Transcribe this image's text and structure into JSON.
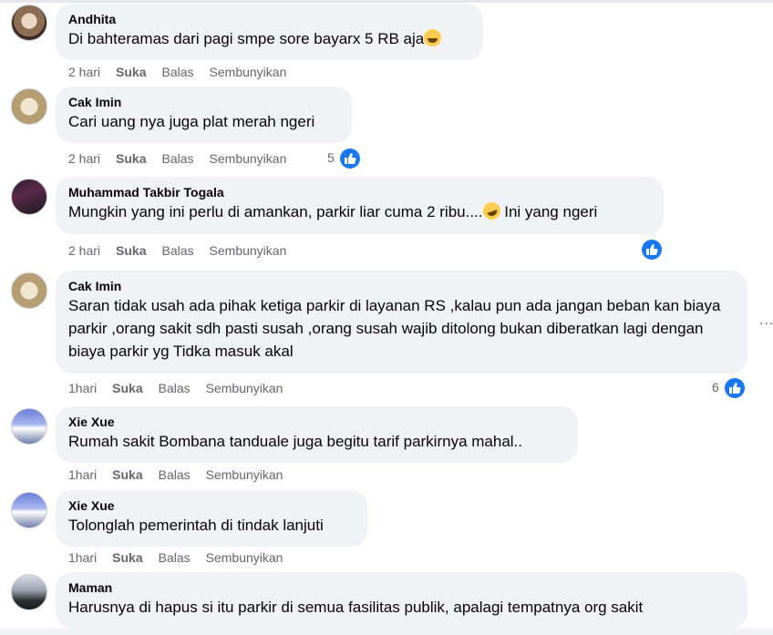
{
  "comments": [
    {
      "author": "Andhita",
      "text": "Di bahteramas dari pagi smpe sore bayarx 5 RB aja",
      "emoji": "smiling-face-icon",
      "time": "2 hari",
      "like": "Suka",
      "reply": "Balas",
      "hide": "Sembunyikan"
    },
    {
      "author": "Cak Imin",
      "text": "Cari uang nya juga plat merah ngeri",
      "time": "2 hari",
      "like": "Suka",
      "reply": "Balas",
      "hide": "Sembunyikan",
      "reaction_count": "5"
    },
    {
      "author": "Muhammad Takbir Togala",
      "text_before": "Mungkin yang ini perlu di amankan, parkir liar cuma 2 ribu....",
      "emoji": "rolling-laughing-icon",
      "text_after": " Ini yang ngeri",
      "time": "2 hari",
      "like": "Suka",
      "reply": "Balas",
      "hide": "Sembunyikan"
    },
    {
      "author": "Cak Imin",
      "text": "Saran tidak usah ada pihak ketiga parkir di layanan RS ,kalau pun ada jangan beban kan biaya parkir ,orang sakit sdh pasti susah ,orang susah wajib ditolong bukan diberatkan lagi dengan biaya parkir yg Tidka masuk akal",
      "time": "1hari",
      "like": "Suka",
      "reply": "Balas",
      "hide": "Sembunyikan",
      "reaction_count": "6"
    },
    {
      "author": "Xie Xue",
      "text": "Rumah sakit Bombana tanduale juga begitu tarif parkirnya mahal..",
      "time": "1hari",
      "like": "Suka",
      "reply": "Balas",
      "hide": "Sembunyikan"
    },
    {
      "author": "Xie Xue",
      "text": "Tolonglah pemerintah di tindak lanjuti",
      "time": "1hari",
      "like": "Suka",
      "reply": "Balas",
      "hide": "Sembunyikan"
    },
    {
      "author": "Maman",
      "text": "Harusnya di hapus si itu parkir di semua fasilitas publik, apalagi tempatnya org sakit"
    }
  ],
  "more_options": "..."
}
